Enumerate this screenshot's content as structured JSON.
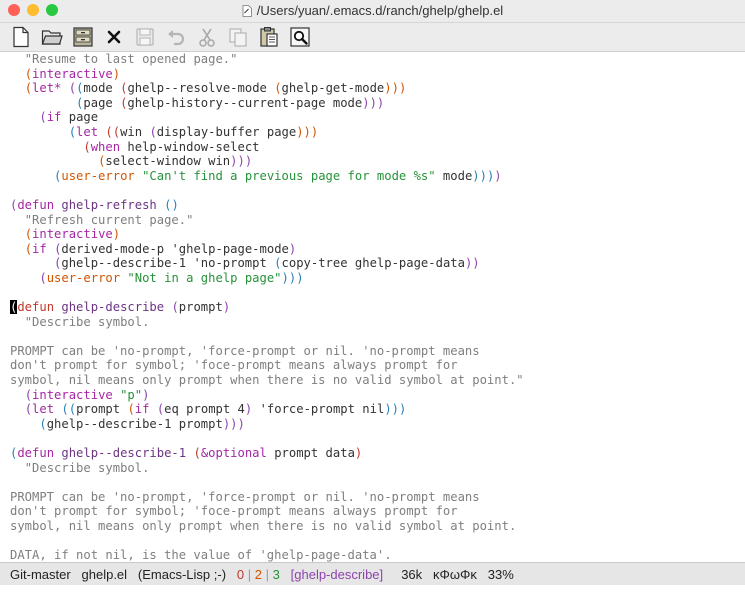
{
  "window": {
    "title": "/Users/yuan/.emacs.d/ranch/ghelp/ghelp.el",
    "traffic_lights": [
      {
        "name": "close",
        "color": "#ff5f57"
      },
      {
        "name": "minimize",
        "color": "#febc2e"
      },
      {
        "name": "zoom",
        "color": "#28c840"
      }
    ]
  },
  "toolbar": {
    "tools": [
      {
        "name": "new-file-icon",
        "enabled": true
      },
      {
        "name": "open-folder-icon",
        "enabled": true
      },
      {
        "name": "dired-icon",
        "enabled": true
      },
      {
        "name": "close-buffer-icon",
        "enabled": true
      },
      {
        "name": "save-icon",
        "enabled": false
      },
      {
        "name": "undo-icon",
        "enabled": false
      },
      {
        "name": "cut-icon",
        "enabled": false
      },
      {
        "name": "copy-icon",
        "enabled": false
      },
      {
        "name": "paste-icon",
        "enabled": true
      },
      {
        "name": "search-icon",
        "enabled": true
      }
    ]
  },
  "colors": {
    "paren1": "#c0392b",
    "paren2": "#d35400",
    "paren3": "#8e44ad",
    "paren4": "#2980b9",
    "keyword": "#a626a4",
    "defname": "#6c3483",
    "string": "#27923a",
    "docstring": "#7f7f7f",
    "plain": "#333333",
    "modeline_name": "#8e44ad",
    "modeline_state": "#c0392b"
  },
  "code_lines": [
    [
      {
        "t": "  "
      },
      {
        "t": "\"Resume to last opened page.\"",
        "c": "docstring"
      }
    ],
    [
      {
        "t": "  "
      },
      {
        "t": "(",
        "c": "paren2"
      },
      {
        "t": "interactive",
        "c": "keyword"
      },
      {
        "t": ")",
        "c": "paren2"
      }
    ],
    [
      {
        "t": "  "
      },
      {
        "t": "(",
        "c": "paren2"
      },
      {
        "t": "let*",
        "c": "keyword"
      },
      {
        "t": " "
      },
      {
        "t": "(",
        "c": "paren3"
      },
      {
        "t": "(",
        "c": "paren4"
      },
      {
        "t": "mode "
      },
      {
        "t": "(",
        "c": "paren1"
      },
      {
        "t": "ghelp--resolve-mode "
      },
      {
        "t": "(",
        "c": "paren2"
      },
      {
        "t": "ghelp-get-mode"
      },
      {
        "t": ")))",
        "c": "paren2"
      }
    ],
    [
      {
        "t": "         "
      },
      {
        "t": "(",
        "c": "paren4"
      },
      {
        "t": "page "
      },
      {
        "t": "(",
        "c": "paren1"
      },
      {
        "t": "ghelp-history--current-page mode"
      },
      {
        "t": ")))",
        "c": "paren3"
      }
    ],
    [
      {
        "t": "    "
      },
      {
        "t": "(",
        "c": "paren3"
      },
      {
        "t": "if",
        "c": "keyword"
      },
      {
        "t": " page"
      }
    ],
    [
      {
        "t": "        "
      },
      {
        "t": "(",
        "c": "paren4"
      },
      {
        "t": "let",
        "c": "keyword"
      },
      {
        "t": " "
      },
      {
        "t": "((",
        "c": "paren1"
      },
      {
        "t": "win "
      },
      {
        "t": "(",
        "c": "paren3"
      },
      {
        "t": "display-buffer page"
      },
      {
        "t": ")))",
        "c": "paren2"
      }
    ],
    [
      {
        "t": "          "
      },
      {
        "t": "(",
        "c": "paren1"
      },
      {
        "t": "when",
        "c": "keyword"
      },
      {
        "t": " help-window-select"
      }
    ],
    [
      {
        "t": "            "
      },
      {
        "t": "(",
        "c": "paren2"
      },
      {
        "t": "select-window win"
      },
      {
        "t": ")))",
        "c": "paren3"
      }
    ],
    [
      {
        "t": "      "
      },
      {
        "t": "(",
        "c": "paren4"
      },
      {
        "t": "user-error",
        "c": "paren2"
      },
      {
        "t": " "
      },
      {
        "t": "\"Can't find a previous page for mode %s\"",
        "c": "string"
      },
      {
        "t": " mode"
      },
      {
        "t": ")))",
        "c": "paren4"
      },
      {
        "t": ")",
        "c": "paren3"
      }
    ],
    [
      {
        "t": ""
      }
    ],
    [
      {
        "t": "(",
        "c": "paren3"
      },
      {
        "t": "defun",
        "c": "keyword"
      },
      {
        "t": " "
      },
      {
        "t": "ghelp-refresh",
        "c": "defname"
      },
      {
        "t": " "
      },
      {
        "t": "()",
        "c": "paren4"
      }
    ],
    [
      {
        "t": "  "
      },
      {
        "t": "\"Refresh current page.\"",
        "c": "docstring"
      }
    ],
    [
      {
        "t": "  "
      },
      {
        "t": "(",
        "c": "paren2"
      },
      {
        "t": "interactive",
        "c": "keyword"
      },
      {
        "t": ")",
        "c": "paren2"
      }
    ],
    [
      {
        "t": "  "
      },
      {
        "t": "(",
        "c": "paren2"
      },
      {
        "t": "if",
        "c": "keyword"
      },
      {
        "t": " "
      },
      {
        "t": "(",
        "c": "paren3"
      },
      {
        "t": "derived-mode-p 'ghelp-page-mode"
      },
      {
        "t": ")",
        "c": "paren3"
      }
    ],
    [
      {
        "t": "      "
      },
      {
        "t": "(",
        "c": "paren3"
      },
      {
        "t": "ghelp--describe-1 'no-prompt "
      },
      {
        "t": "(",
        "c": "paren4"
      },
      {
        "t": "copy-tree ghelp-page-data"
      },
      {
        "t": "))",
        "c": "paren3"
      }
    ],
    [
      {
        "t": "    "
      },
      {
        "t": "(",
        "c": "paren3"
      },
      {
        "t": "user-error",
        "c": "paren2"
      },
      {
        "t": " "
      },
      {
        "t": "\"Not in a ghelp page\"",
        "c": "string"
      },
      {
        "t": ")))",
        "c": "paren4"
      }
    ],
    [
      {
        "t": ""
      }
    ],
    [
      {
        "t": "(",
        "c": "cursor"
      },
      {
        "t": "defun",
        "c": "paren1"
      },
      {
        "t": " "
      },
      {
        "t": "ghelp-describe",
        "c": "defname"
      },
      {
        "t": " "
      },
      {
        "t": "(",
        "c": "paren3"
      },
      {
        "t": "prompt"
      },
      {
        "t": ")",
        "c": "paren3"
      }
    ],
    [
      {
        "t": "  "
      },
      {
        "t": "\"Describe symbol.",
        "c": "docstring"
      }
    ],
    [
      {
        "t": ""
      }
    ],
    [
      {
        "t": "PROMPT can be 'no-prompt, 'force-prompt or nil. 'no-prompt means",
        "c": "docstring"
      }
    ],
    [
      {
        "t": "don't prompt for symbol; 'foce-prompt means always prompt for",
        "c": "docstring"
      }
    ],
    [
      {
        "t": "symbol, nil means only prompt when there is no valid symbol at point.\"",
        "c": "docstring"
      }
    ],
    [
      {
        "t": "  "
      },
      {
        "t": "(",
        "c": "paren3"
      },
      {
        "t": "interactive",
        "c": "keyword"
      },
      {
        "t": " "
      },
      {
        "t": "\"p\"",
        "c": "string"
      },
      {
        "t": ")",
        "c": "paren3"
      }
    ],
    [
      {
        "t": "  "
      },
      {
        "t": "(",
        "c": "paren3"
      },
      {
        "t": "let",
        "c": "keyword"
      },
      {
        "t": " "
      },
      {
        "t": "((",
        "c": "paren4"
      },
      {
        "t": "prompt "
      },
      {
        "t": "(",
        "c": "paren2"
      },
      {
        "t": "if",
        "c": "keyword"
      },
      {
        "t": " "
      },
      {
        "t": "(",
        "c": "paren3"
      },
      {
        "t": "eq prompt 4"
      },
      {
        "t": ")",
        "c": "paren3"
      },
      {
        "t": " 'force-prompt nil"
      },
      {
        "t": ")))",
        "c": "paren4"
      }
    ],
    [
      {
        "t": "    "
      },
      {
        "t": "(",
        "c": "paren4"
      },
      {
        "t": "ghelp--describe-1 prompt"
      },
      {
        "t": ")))",
        "c": "paren3"
      }
    ],
    [
      {
        "t": ""
      }
    ],
    [
      {
        "t": "(",
        "c": "paren4"
      },
      {
        "t": "defun",
        "c": "keyword"
      },
      {
        "t": " "
      },
      {
        "t": "ghelp--describe-1",
        "c": "defname"
      },
      {
        "t": " "
      },
      {
        "t": "(",
        "c": "paren1"
      },
      {
        "t": "&optional",
        "c": "keyword"
      },
      {
        "t": " prompt data"
      },
      {
        "t": ")",
        "c": "paren1"
      }
    ],
    [
      {
        "t": "  "
      },
      {
        "t": "\"Describe symbol.",
        "c": "docstring"
      }
    ],
    [
      {
        "t": ""
      }
    ],
    [
      {
        "t": "PROMPT can be 'no-prompt, 'force-prompt or nil. 'no-prompt means",
        "c": "docstring"
      }
    ],
    [
      {
        "t": "don't prompt for symbol; 'foce-prompt means always prompt for",
        "c": "docstring"
      }
    ],
    [
      {
        "t": "symbol, nil means only prompt when there is no valid symbol at point.",
        "c": "docstring"
      }
    ],
    [
      {
        "t": ""
      }
    ],
    [
      {
        "t": "DATA, if not nil, is the value of 'ghelp-page-data'.",
        "c": "docstring"
      }
    ]
  ],
  "modeline": {
    "branch": "Git-master",
    "buffer": "ghelp.el",
    "mode": "(Emacs-Lisp ;-)",
    "errors": "0",
    "warnings": "2",
    "infos": "3",
    "function": "[ghelp-describe]",
    "size": "36k",
    "state": "κΦωΦκ",
    "position": "33%"
  }
}
